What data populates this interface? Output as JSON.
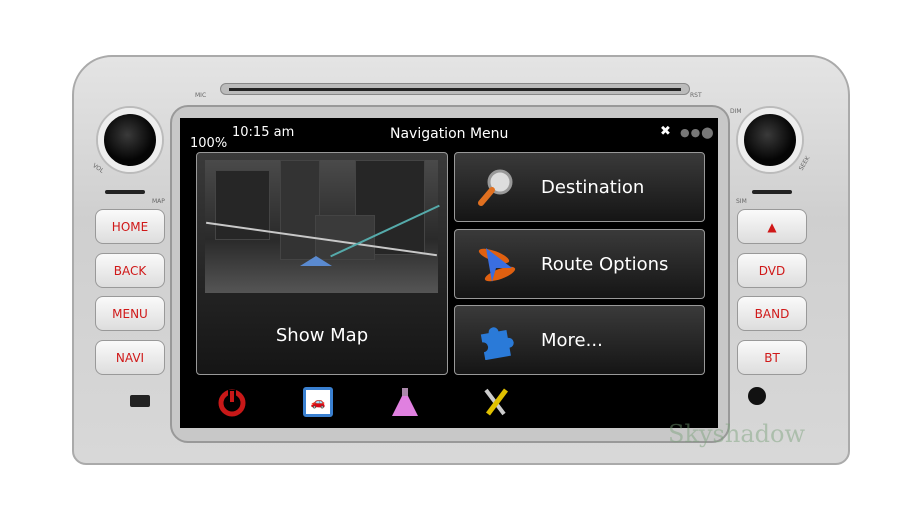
{
  "device": {
    "mic_label": "MIC",
    "rst_label": "RST",
    "vol_label": "VOL",
    "seek_label": "SEEK",
    "dim_label": "DIM",
    "map_label": "MAP",
    "sim_label": "SIM",
    "watermark": "Skyshadow",
    "left_buttons": [
      "HOME",
      "BACK",
      "MENU",
      "NAVI"
    ],
    "right_buttons": [
      {
        "label": "",
        "icon": "eject-icon"
      },
      {
        "label": "DVD"
      },
      {
        "label": "BAND"
      },
      {
        "label": "BT"
      }
    ],
    "button_text_color": "#d01818"
  },
  "status": {
    "battery": "100%",
    "time": "10:15 am",
    "title": "Navigation Menu",
    "gps_icon": "satellite-icon"
  },
  "main": {
    "show_map": "Show Map",
    "tiles": [
      {
        "label": "Destination",
        "icon": "magnifier-icon"
      },
      {
        "label": "Route Options",
        "icon": "route-arrow-icon"
      },
      {
        "label": "More...",
        "icon": "puzzle-icon"
      }
    ]
  },
  "bottom_icons": [
    "power-icon",
    "traffic-icon",
    "flask-icon",
    "tools-icon"
  ]
}
